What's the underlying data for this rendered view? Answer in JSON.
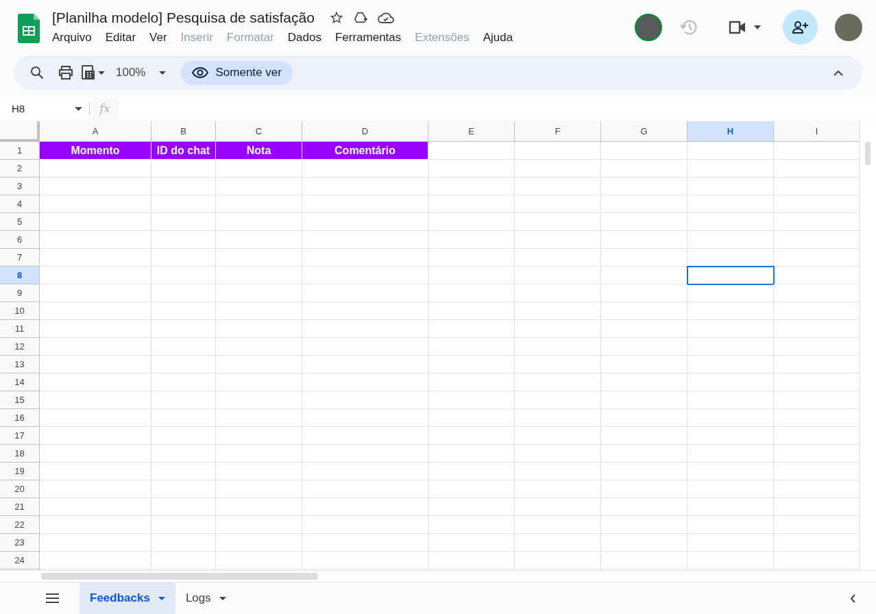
{
  "document": {
    "title": "[Planilha modelo] Pesquisa de satisfação"
  },
  "menu": [
    {
      "label": "Arquivo",
      "disabled": false
    },
    {
      "label": "Editar",
      "disabled": false
    },
    {
      "label": "Ver",
      "disabled": false
    },
    {
      "label": "Inserir",
      "disabled": true
    },
    {
      "label": "Formatar",
      "disabled": true
    },
    {
      "label": "Dados",
      "disabled": false
    },
    {
      "label": "Ferramentas",
      "disabled": false
    },
    {
      "label": "Extensões",
      "disabled": true
    },
    {
      "label": "Ajuda",
      "disabled": false
    }
  ],
  "toolbar": {
    "zoom": "100%",
    "mode": "Somente ver"
  },
  "formula_bar": {
    "name_box": "H8",
    "fx": "fx"
  },
  "columns": [
    {
      "label": "A",
      "selected": false
    },
    {
      "label": "B",
      "selected": false
    },
    {
      "label": "C",
      "selected": false
    },
    {
      "label": "D",
      "selected": false
    },
    {
      "label": "E",
      "selected": false
    },
    {
      "label": "F",
      "selected": false
    },
    {
      "label": "G",
      "selected": false
    },
    {
      "label": "H",
      "selected": true
    },
    {
      "label": "I",
      "selected": false
    }
  ],
  "rows": [
    {
      "label": "1",
      "selected": false,
      "cells": [
        "Momento",
        "ID do chat",
        "Nota",
        "Comentário"
      ]
    },
    {
      "label": "2",
      "selected": false
    },
    {
      "label": "3",
      "selected": false
    },
    {
      "label": "4",
      "selected": false
    },
    {
      "label": "5",
      "selected": false
    },
    {
      "label": "6",
      "selected": false
    },
    {
      "label": "7",
      "selected": false
    },
    {
      "label": "8",
      "selected": true
    },
    {
      "label": "9",
      "selected": false
    },
    {
      "label": "10",
      "selected": false
    },
    {
      "label": "11",
      "selected": false
    },
    {
      "label": "12",
      "selected": false
    },
    {
      "label": "13",
      "selected": false
    },
    {
      "label": "14",
      "selected": false
    },
    {
      "label": "15",
      "selected": false
    },
    {
      "label": "16",
      "selected": false
    },
    {
      "label": "17",
      "selected": false
    },
    {
      "label": "18",
      "selected": false
    },
    {
      "label": "19",
      "selected": false
    },
    {
      "label": "20",
      "selected": false
    },
    {
      "label": "21",
      "selected": false
    },
    {
      "label": "22",
      "selected": false
    },
    {
      "label": "23",
      "selected": false
    },
    {
      "label": "24",
      "selected": false
    }
  ],
  "sheets": [
    {
      "label": "Feedbacks",
      "selected": true
    },
    {
      "label": "Logs",
      "selected": false
    }
  ]
}
